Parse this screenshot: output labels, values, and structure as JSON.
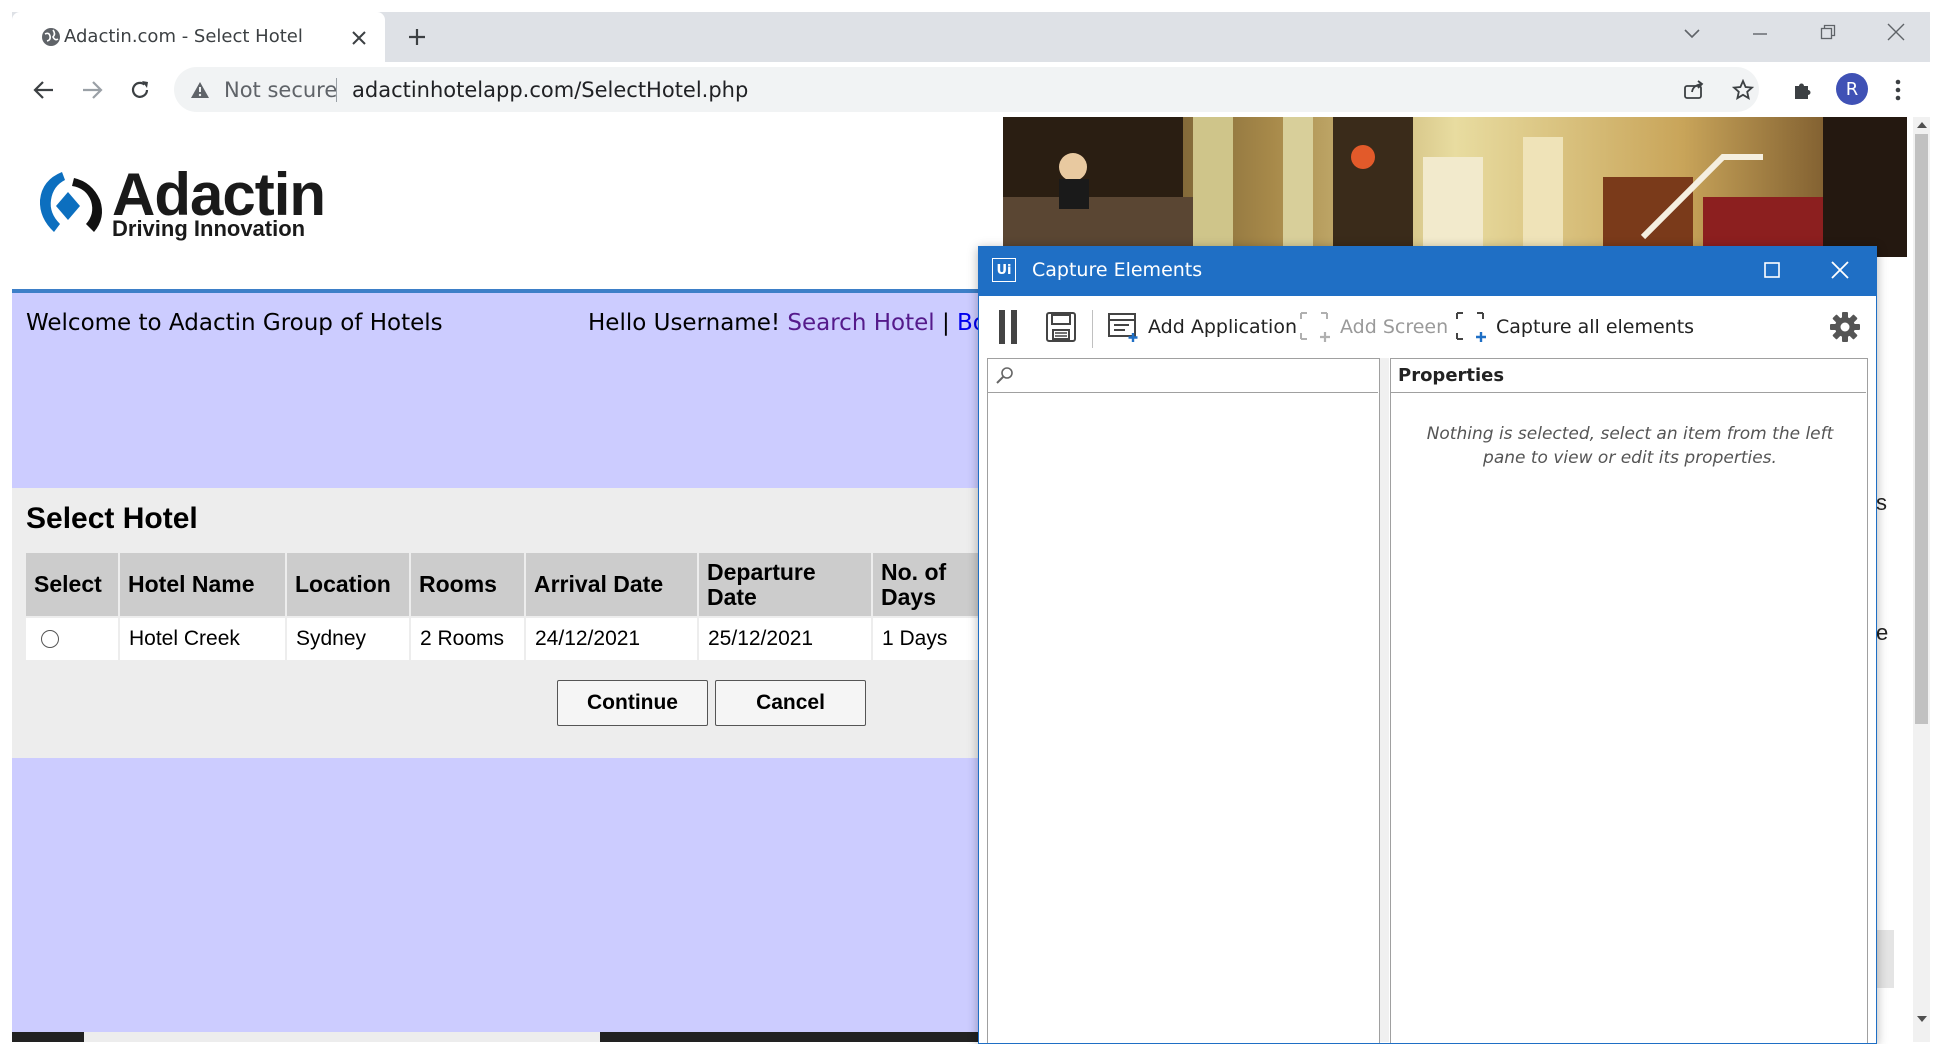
{
  "browser": {
    "tab_title": "Adactin.com - Select Hotel",
    "security_label": "Not secure",
    "url": "adactinhotelapp.com/SelectHotel.php",
    "profile_initial": "R"
  },
  "site": {
    "logo_brand": "Adactin",
    "logo_tagline": "Driving Innovation",
    "welcome": "Welcome to Adactin Group of Hotels",
    "hello_prefix": "Hello Username!",
    "nav_search": "Search Hotel",
    "nav_sep": "|",
    "nav_booked": "Book"
  },
  "select_hotel": {
    "title": "Select Hotel",
    "columns": [
      "Select",
      "Hotel Name",
      "Location",
      "Rooms",
      "Arrival Date",
      "Departure Date",
      "No. of Days"
    ],
    "rows": [
      {
        "hotel_name": "Hotel Creek",
        "location": "Sydney",
        "rooms": "2 Rooms",
        "arrival": "24/12/2021",
        "departure": "25/12/2021",
        "days": "1 Days"
      }
    ],
    "continue_label": "Continue",
    "cancel_label": "Cancel"
  },
  "edge_text": {
    "a": "s",
    "b": "e"
  },
  "capture_dialog": {
    "app_icon": "Ui",
    "title": "Capture Elements",
    "toolbar": {
      "add_application": "Add Application",
      "add_screen": "Add Screen",
      "capture_all": "Capture all elements"
    },
    "properties_header": "Properties",
    "empty_message": "Nothing is selected, select an item from the left pane to view or edit its properties."
  },
  "colors": {
    "accent_blue": "#1f6fc5",
    "lavender": "#ccccff",
    "link_purple": "#551a8b"
  }
}
